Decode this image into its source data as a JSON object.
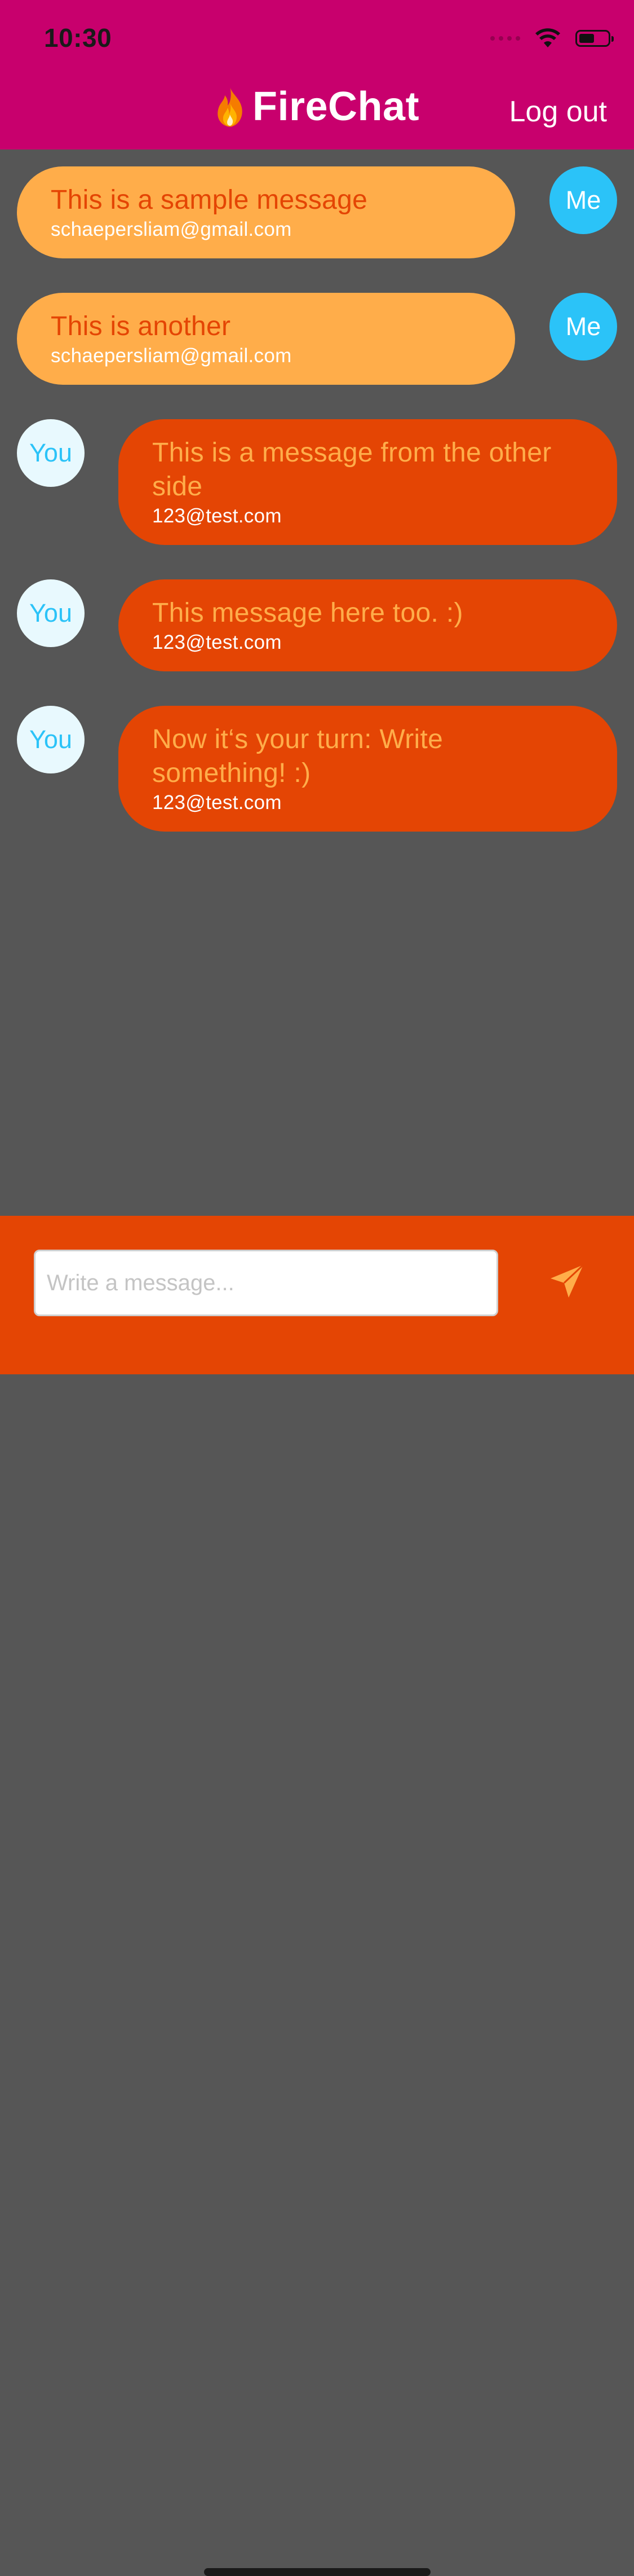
{
  "status_bar": {
    "time": "10:30"
  },
  "header": {
    "title": "FireChat",
    "logout_label": "Log out"
  },
  "messages": [
    {
      "side": "me",
      "text": "This is a sample message",
      "sender": "schaepersliam@gmail.com",
      "avatar": "Me"
    },
    {
      "side": "me",
      "text": "This is another",
      "sender": "schaepersliam@gmail.com",
      "avatar": "Me"
    },
    {
      "side": "you",
      "text": "This is a message from the other side",
      "sender": "123@test.com",
      "avatar": "You"
    },
    {
      "side": "you",
      "text": "This message here too. :)",
      "sender": "123@test.com",
      "avatar": "You"
    },
    {
      "side": "you",
      "text": "Now it‘s your turn: Write something! :)",
      "sender": "123@test.com",
      "avatar": "You"
    }
  ],
  "composer": {
    "placeholder": "Write a message...",
    "value": ""
  },
  "icons": {
    "title_icon": "fire-icon",
    "send_icon": "paper-plane-icon",
    "wifi_icon": "wifi-icon",
    "battery_icon": "battery-icon"
  },
  "colors": {
    "header": "#C8006D",
    "background": "#565656",
    "my_bubble": "#FFAD4A",
    "their_bubble": "#E44504",
    "my_avatar": "#2BC3F8",
    "their_avatar": "#E8F9FE",
    "composer": "#E44504"
  }
}
